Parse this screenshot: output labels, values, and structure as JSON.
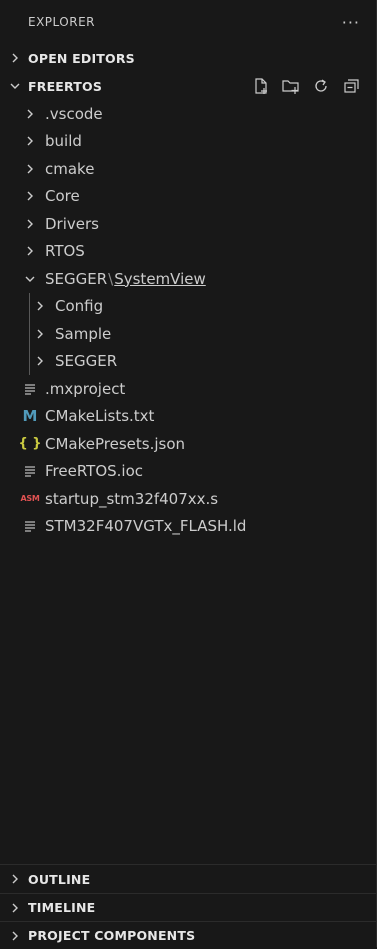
{
  "title": "EXPLORER",
  "more_label": "···",
  "sections": {
    "open_editors": "OPEN EDITORS",
    "workspace": "FREERTOS",
    "outline": "OUTLINE",
    "timeline": "TIMELINE",
    "project_components": "PROJECT COMPONENTS"
  },
  "folders": [
    ".vscode",
    "build",
    "cmake",
    "Core",
    "Drivers",
    "RTOS"
  ],
  "segger": {
    "parent": "SEGGER",
    "separator": "\\",
    "child": "SystemView"
  },
  "segger_children": [
    "Config",
    "Sample",
    "SEGGER"
  ],
  "files": [
    {
      "name": ".mxproject",
      "icon": "lines-icon"
    },
    {
      "name": "CMakeLists.txt",
      "icon": "cmake-m-icon"
    },
    {
      "name": "CMakePresets.json",
      "icon": "json-braces-icon"
    },
    {
      "name": "FreeRTOS.ioc",
      "icon": "lines-icon"
    },
    {
      "name": "startup_stm32f407xx.s",
      "icon": "asm-icon"
    },
    {
      "name": "STM32F407VGTx_FLASH.ld",
      "icon": "lines-icon"
    }
  ],
  "icon_labels": {
    "asm": "ASM",
    "json": "{ }",
    "cmake": "M"
  },
  "colors": {
    "background": "#181818",
    "text": "#cccccc",
    "json": "#cbcb41",
    "cmake": "#519aba",
    "asm": "#e05252"
  }
}
